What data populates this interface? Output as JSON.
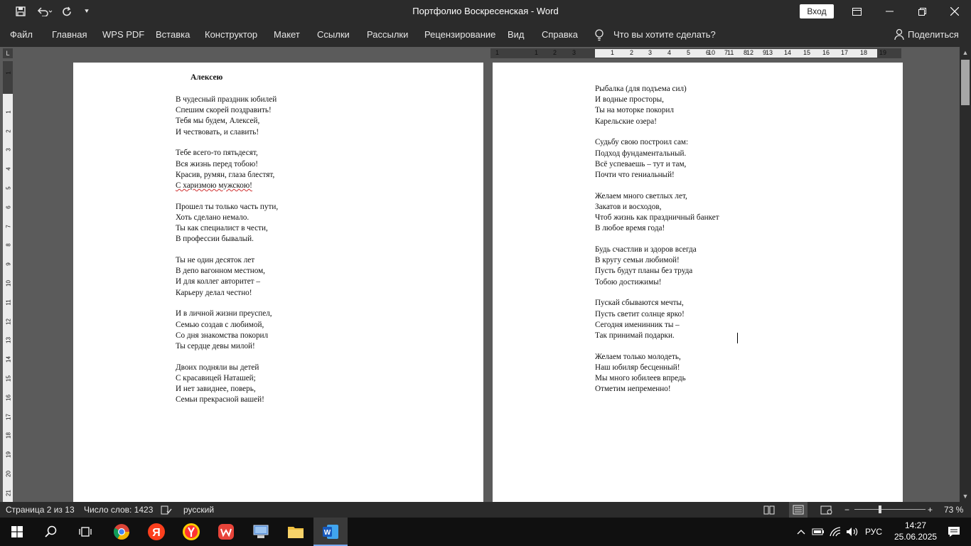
{
  "window": {
    "title": "Портфолио Воскресенская  -  Word",
    "signin_label": "Вход"
  },
  "ribbon": {
    "tabs": [
      "Файл",
      "Главная",
      "WPS PDF",
      "Вставка",
      "Конструктор",
      "Макет",
      "Ссылки",
      "Рассылки",
      "Рецензирование",
      "Вид",
      "Справка"
    ],
    "tell_me": "Что вы хотите сделать?",
    "share": "Поделиться"
  },
  "ruler": {
    "h_ticks": [
      "1",
      "1",
      "2",
      "3",
      "4",
      "5",
      "6",
      "7",
      "8",
      "9",
      "10",
      "11",
      "12",
      "13",
      "14",
      "15",
      "16",
      "17",
      "18",
      "19"
    ],
    "v_ticks": [
      "1",
      "1",
      "2",
      "3",
      "4",
      "5",
      "6",
      "7",
      "8",
      "9",
      "10",
      "11",
      "12",
      "13",
      "14",
      "15",
      "16",
      "17",
      "18",
      "19",
      "20",
      "21"
    ]
  },
  "page1": {
    "title": "Алексею",
    "stanzas": [
      [
        "В чудесный праздник юбилей",
        "Спешим скорей поздравить!",
        "Тебя мы будем, Алексей,",
        "И чествовать, и славить!"
      ],
      [
        "Тебе всего-то пятьдесят,",
        "Вся жизнь перед тобою!",
        "Красив, румян, глаза блестят,",
        "С харизмою мужскою!"
      ],
      [
        "Прошел ты только часть пути,",
        "Хоть сделано немало.",
        "Ты как специалист в чести,",
        "В профессии бывалый."
      ],
      [
        "Ты не один десяток лет",
        "В депо вагонном местном,",
        "И для коллег авторитет –",
        "Карьеру делал честно!"
      ],
      [
        "И в личной жизни преуспел,",
        "Семью создав с любимой,",
        "Со дня знакомства покорил",
        "Ты сердце девы милой!"
      ],
      [
        "Двоих подняли вы детей",
        "С красавицей Наташей;",
        "И нет завиднее, поверь,",
        "Семьи прекрасной вашей!"
      ]
    ]
  },
  "page2": {
    "stanzas": [
      [
        "Рыбалка (для подъема сил)",
        "И водные просторы,",
        "Ты на моторке покорил",
        "Карельские озера!"
      ],
      [
        "Судьбу свою построил сам:",
        "Подход фундаментальный.",
        "Всё успеваешь – тут и там,",
        "Почти что гениальный!"
      ],
      [
        "Желаем много светлых лет,",
        "Закатов и восходов,",
        "Чтоб жизнь как праздничный банкет",
        "В любое время года!"
      ],
      [
        "Будь счастлив и здоров всегда",
        "В кругу семьи любимой!",
        "Пусть будут планы без труда",
        "Тобою достижимы!"
      ],
      [
        "Пускай сбываются мечты,",
        "Пусть светит солнце ярко!",
        "Сегодня именинник ты –",
        "Так принимай подарки."
      ],
      [
        "Желаем только молодеть,",
        "Наш юбиляр бесценный!",
        "Мы много юбилеев впредь",
        "Отметим непременно!"
      ]
    ]
  },
  "status": {
    "page": "Страница 2 из 13",
    "words": "Число слов: 1423",
    "language": "русский",
    "zoom": "73 %"
  },
  "taskbar": {
    "lang": "РУС",
    "time": "14:27",
    "date": "25.06.2025"
  }
}
